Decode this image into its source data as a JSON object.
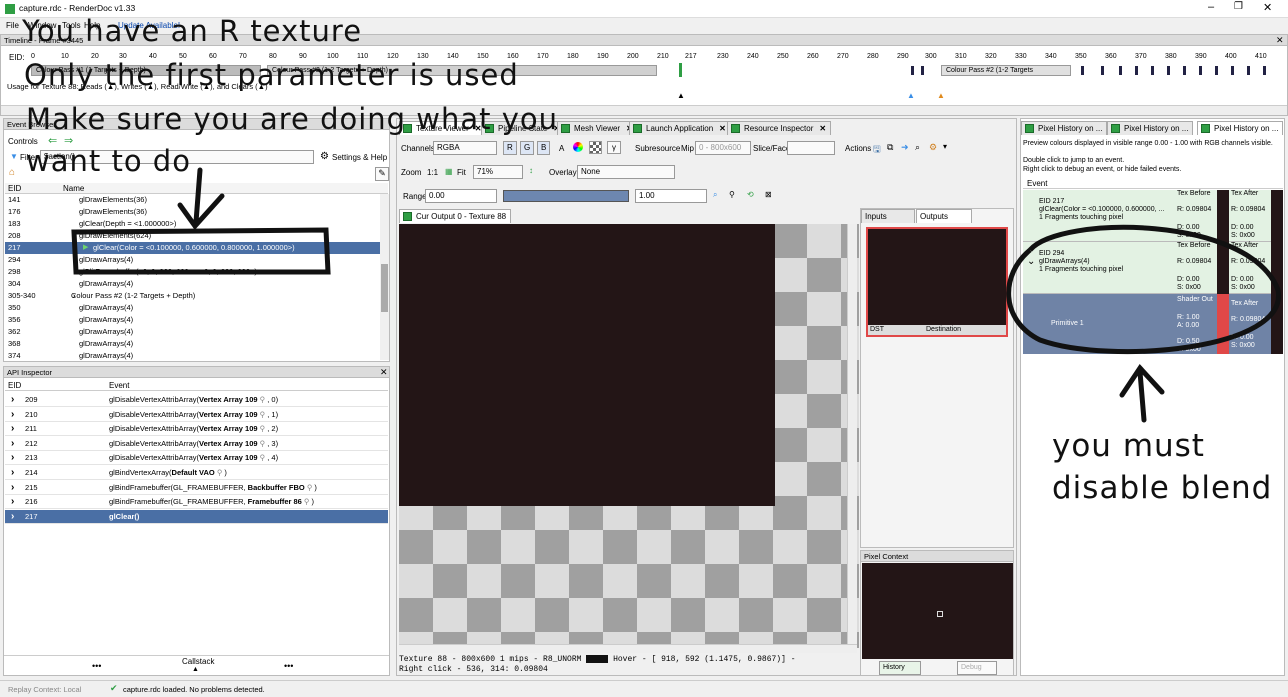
{
  "title": "capture.rdc - RenderDoc v1.33",
  "menu": [
    "File",
    "Window",
    "Tools",
    "Help",
    "Update Available!"
  ],
  "timeline": {
    "header": "Timeline - Frame #3445",
    "eid_label": "EID:",
    "ticks": [
      "0",
      "10",
      "20",
      "30",
      "40",
      "50",
      "60",
      "70",
      "80",
      "90",
      "100",
      "110",
      "120",
      "130",
      "140",
      "150",
      "160",
      "170",
      "180",
      "190",
      "200",
      "210",
      "217",
      "230",
      "240",
      "250",
      "260",
      "270",
      "280",
      "290",
      "300",
      "310",
      "320",
      "330",
      "340",
      "350",
      "360",
      "370",
      "380",
      "390",
      "400",
      "410"
    ],
    "pass1": "Colour Pass #1 (1 Targets + Depth)",
    "pass2": "Colour Pass #2 (1-2 Targets + Depth)",
    "pass3": "Colour Pass #2 (1-2 Targets",
    "usage": "Usage for Texture 88: Reads (▲), Writes (▲), Read/Write (▲), and Clears (▲)"
  },
  "event_browser": {
    "header": "Event Browser",
    "controls_label": "Controls",
    "filter_label": "Filter",
    "filter_value": "$action()",
    "settings_label": "Settings & Help",
    "col_eid": "EID",
    "col_name": "Name",
    "rows": [
      {
        "eid": "141",
        "name": "glDrawElements(36)"
      },
      {
        "eid": "176",
        "name": "glDrawElements(36)"
      },
      {
        "eid": "183",
        "name": "glClear(Depth = <1.000000>)"
      },
      {
        "eid": "208",
        "name": "glDrawElements(624)"
      },
      {
        "eid": "217",
        "name": "glClear(Color = <0.100000, 0.600000, 0.800000, 1.000000>)"
      },
      {
        "eid": "294",
        "name": "glDrawArrays(4)"
      },
      {
        "eid": "298",
        "name": "glBlitFramebuffer(<0, 0, 800, 600> - <0, 0, 800, 600>)"
      },
      {
        "eid": "304",
        "name": "glDrawArrays(4)"
      },
      {
        "eid": "305-340",
        "name": "Colour Pass #2 (1-2 Targets + Depth)"
      },
      {
        "eid": "350",
        "name": "glDrawArrays(4)"
      },
      {
        "eid": "356",
        "name": "glDrawArrays(4)"
      },
      {
        "eid": "362",
        "name": "glDrawArrays(4)"
      },
      {
        "eid": "368",
        "name": "glDrawArrays(4)"
      },
      {
        "eid": "374",
        "name": "glDrawArrays(4)"
      }
    ]
  },
  "api_inspector": {
    "header": "API Inspector",
    "col_eid": "EID",
    "col_event": "Event",
    "rows": [
      {
        "eid": "209",
        "fn": "glDisableVertexAttribArray(",
        "bold": "Vertex Array 109",
        "rest": " , 0)"
      },
      {
        "eid": "210",
        "fn": "glDisableVertexAttribArray(",
        "bold": "Vertex Array 109",
        "rest": " , 1)"
      },
      {
        "eid": "211",
        "fn": "glDisableVertexAttribArray(",
        "bold": "Vertex Array 109",
        "rest": " , 2)"
      },
      {
        "eid": "212",
        "fn": "glDisableVertexAttribArray(",
        "bold": "Vertex Array 109",
        "rest": " , 3)"
      },
      {
        "eid": "213",
        "fn": "glDisableVertexAttribArray(",
        "bold": "Vertex Array 109",
        "rest": " , 4)"
      },
      {
        "eid": "214",
        "fn": "glBindVertexArray(",
        "bold": "Default VAO",
        "rest": " )"
      },
      {
        "eid": "215",
        "fn": "glBindFramebuffer(GL_FRAMEBUFFER, ",
        "bold": "Backbuffer FBO",
        "rest": " )"
      },
      {
        "eid": "216",
        "fn": "glBindFramebuffer(GL_FRAMEBUFFER, ",
        "bold": "Framebuffer 86",
        "rest": " )"
      },
      {
        "eid": "217",
        "fn": "glClear()",
        "bold": "",
        "rest": ""
      }
    ],
    "callstack": "Callstack",
    "dots": "•••"
  },
  "texture_viewer": {
    "tabs": [
      "Texture Viewer",
      "Pipeline State",
      "Mesh Viewer",
      "Launch Application",
      "Resource Inspector"
    ],
    "channels_label": "Channels",
    "channels_value": "RGBA",
    "ch_r": "R",
    "ch_g": "G",
    "ch_b": "B",
    "ch_a": "A",
    "subresource_label": "Subresource",
    "mip_label": "Mip",
    "mip_value": "0 - 800x600",
    "slice_label": "Slice/Face",
    "actions_label": "Actions",
    "zoom_label": "Zoom",
    "zoom_11": "1:1",
    "fit_label": "Fit",
    "zoom_value": "71%",
    "overlay_label": "Overlay",
    "overlay_value": "None",
    "range_label": "Range",
    "range_min": "0.00",
    "range_max": "1.00",
    "output_tab": "Cur Output 0 - Texture 88",
    "inputs_tab": "Inputs",
    "outputs_tab": "Outputs",
    "thumb_left": "DST",
    "thumb_right": "Destination",
    "pixel_context": "Pixel Context",
    "history_btn": "History",
    "debug_btn": "Debug",
    "status1": "Texture 88 - 800x600 1 mips - R8_UNORM",
    "status1b": "Hover - [ 918,  592 (1.1475, 0.9867)] -",
    "status2": "Right click -  536,  314: 0.09804"
  },
  "pixel_history": {
    "tabs": [
      "Pixel History on ...",
      "Pixel History on ...",
      "Pixel History on ..."
    ],
    "info1": "Preview colours displayed in visible range 0.00 - 1.00 with RGB channels visible.",
    "info2": "Double click to jump to an event.",
    "info3": "Right click to debug an event, or hide failed events.",
    "col_event": "Event",
    "entries": [
      {
        "title": "EID 217",
        "desc": "glClear(Color = <0.100000, 0.600000, ...",
        "sub": "1 Fragments touching pixel",
        "h1": "Tex Before",
        "h2": "Tex After",
        "v1": "R: 0.09804",
        "v2": "R: 0.09804",
        "d1": "D: 0.00",
        "s1": "S: 0x00",
        "d2": "D: 0.00",
        "s2": "S: 0x00"
      },
      {
        "title": "EID 294",
        "desc": "glDrawArrays(4)",
        "sub": "1 Fragments touching pixel",
        "h1": "Tex Before",
        "h2": "Tex After",
        "v1": "R: 0.09804",
        "v2": "R: 0.09804",
        "d1": "D: 0.00",
        "s1": "S: 0x00",
        "d2": "D: 0.00",
        "s2": "S: 0x00"
      }
    ],
    "primitive": {
      "label": "Primitive 1",
      "h1": "Shader Out",
      "h2": "Tex After",
      "v1": "R: 1.00",
      "a1": "A: 0.00",
      "v2": "R: 0.09804",
      "d1": "D: 0.50",
      "s1": "S: 0x00",
      "d2": "D: 0.00",
      "s2": "S: 0x00"
    }
  },
  "status_bar": {
    "replay": "Replay Context: Local",
    "loaded": "capture.rdc loaded. No problems detected."
  },
  "annotations": {
    "line1": "You have an R texture",
    "line2": "Only the first parameter is used",
    "line3": "Make sure you are doing what you",
    "line4": "want to do",
    "line5": "you must",
    "line6": "disable blend"
  }
}
